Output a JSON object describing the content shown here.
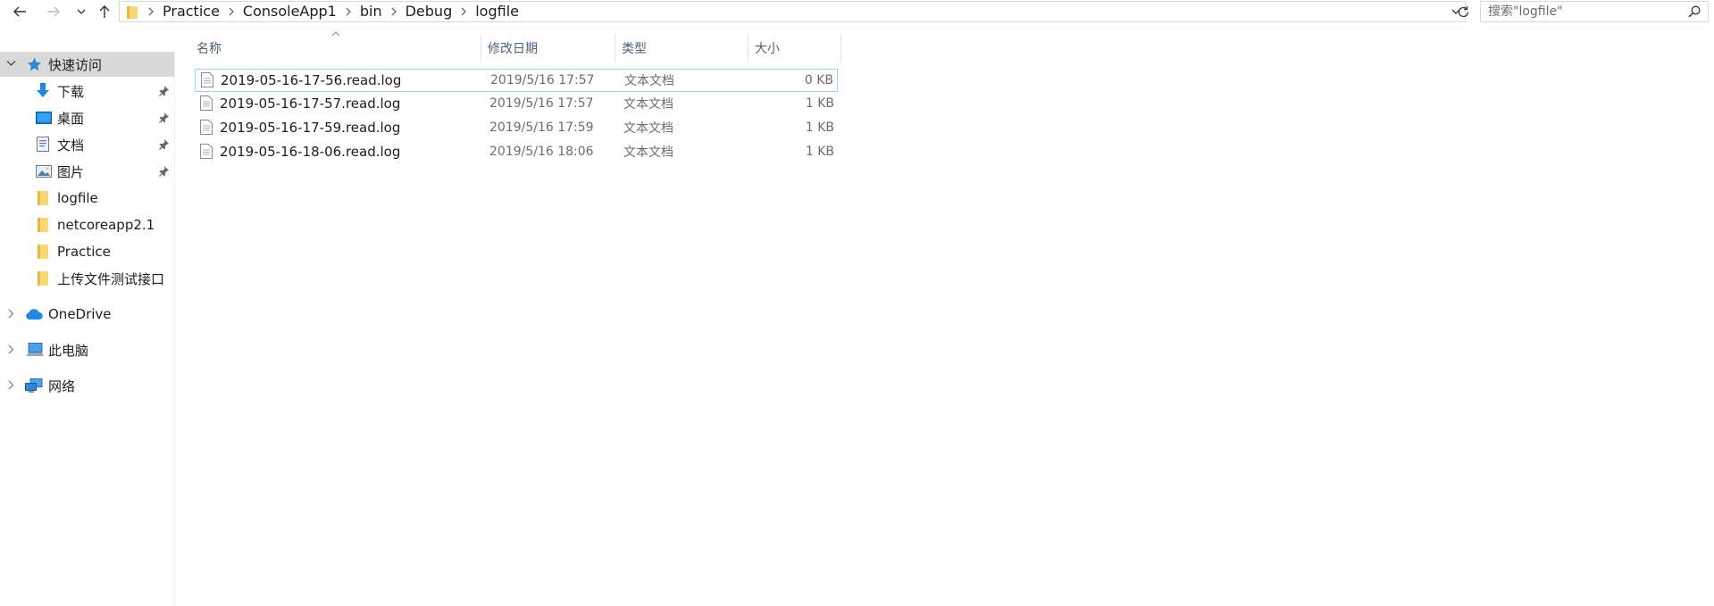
{
  "toolbar": {
    "back_icon": "arrow-left-icon",
    "forward_icon": "arrow-right-icon",
    "recent_icon": "chevron-down-icon",
    "up_icon": "arrow-up-icon"
  },
  "address": {
    "breadcrumb": [
      "Practice",
      "ConsoleApp1",
      "bin",
      "Debug",
      "logfile"
    ]
  },
  "search": {
    "placeholder": "搜索\"logfile\""
  },
  "sidebar": {
    "quick_access_label": "快速访问",
    "items": [
      {
        "label": "下载",
        "icon": "download-icon",
        "pinned": true
      },
      {
        "label": "桌面",
        "icon": "desktop-icon",
        "pinned": true
      },
      {
        "label": "文档",
        "icon": "documents-icon",
        "pinned": true
      },
      {
        "label": "图片",
        "icon": "pictures-icon",
        "pinned": true
      },
      {
        "label": "logfile",
        "icon": "folder-icon",
        "pinned": false
      },
      {
        "label": "netcoreapp2.1",
        "icon": "folder-icon",
        "pinned": false
      },
      {
        "label": "Practice",
        "icon": "folder-icon",
        "pinned": false
      },
      {
        "label": "上传文件测试接口",
        "icon": "folder-icon",
        "pinned": false
      }
    ],
    "onedrive_label": "OneDrive",
    "thispc_label": "此电脑",
    "network_label": "网络"
  },
  "columns": {
    "name": "名称",
    "date": "修改日期",
    "type": "类型",
    "size": "大小"
  },
  "files": [
    {
      "name": "2019-05-16-17-56.read.log",
      "date": "2019/5/16 17:57",
      "type": "文本文档",
      "size": "0 KB"
    },
    {
      "name": "2019-05-16-17-57.read.log",
      "date": "2019/5/16 17:57",
      "type": "文本文档",
      "size": "1 KB"
    },
    {
      "name": "2019-05-16-17-59.read.log",
      "date": "2019/5/16 17:59",
      "type": "文本文档",
      "size": "1 KB"
    },
    {
      "name": "2019-05-16-18-06.read.log",
      "date": "2019/5/16 18:06",
      "type": "文本文档",
      "size": "1 KB"
    }
  ],
  "colors": {
    "selection_bg": "#d9d9d9",
    "row_selected_border": "#99d1ff",
    "header_text": "#4c607a",
    "folder_yellow": "#f8d775",
    "accent_blue": "#1e88e5"
  }
}
